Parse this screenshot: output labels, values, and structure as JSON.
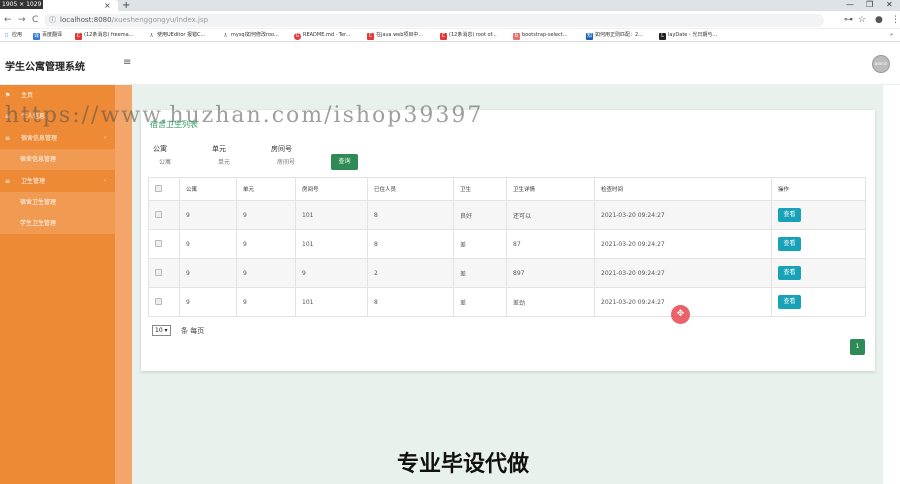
{
  "browser": {
    "tab_dim_badge": "1905 × 1029",
    "tab_close": "×",
    "new_tab": "+",
    "win_min": "—",
    "win_max": "❐",
    "win_close": "✕",
    "back": "←",
    "forward": "→",
    "reload": "C",
    "url_icon": "ⓘ",
    "url_host": "localhost:8080",
    "url_path": "/xueshenggongyu/index.jsp",
    "key_icon": "⊶",
    "star_icon": "☆",
    "profile_icon": "●",
    "menu_icon": "⋮",
    "bookmarks": [
      {
        "label": "应用",
        "color": "#4285f4",
        "icon": "⠿"
      },
      {
        "label": "百度翻译",
        "color": "#3a7bd5",
        "icon": "译"
      },
      {
        "label": "(12条消息) freema...",
        "color": "#e53935",
        "icon": "C"
      },
      {
        "label": "使用UEditor 报错C...",
        "color": "#555555",
        "icon": "ƛ"
      },
      {
        "label": "mysql如何修改roo...",
        "color": "#555555",
        "icon": "ƛ"
      },
      {
        "label": "README.md · Ter...",
        "color": "#e53935",
        "icon": "G"
      },
      {
        "label": "在java web项目中...",
        "color": "#e53935",
        "icon": "C"
      },
      {
        "label": "(12条消息) root of...",
        "color": "#e53935",
        "icon": "C"
      },
      {
        "label": "bootstrap-select...",
        "color": "#e57373",
        "icon": "b"
      },
      {
        "label": "如何用正则匹配：2...",
        "color": "#1565c0",
        "icon": "知"
      },
      {
        "label": "layDate - 光日期与...",
        "color": "#222222",
        "icon": "L"
      },
      {
        "label": "»",
        "color": "#ffffff",
        "icon": ""
      }
    ]
  },
  "app": {
    "title": "学生公寓管理系统",
    "hamburger": "≡",
    "avatar_text": "admin"
  },
  "sidebar": {
    "items": [
      {
        "icon": "⚑",
        "label": "主页",
        "arrow": ""
      },
      {
        "icon": "≡",
        "label": "个人信息",
        "arrow": ""
      },
      {
        "icon": "≡",
        "label": "宿舍信息管理",
        "arrow": "‹"
      },
      {
        "icon": "",
        "label": "宿舍信息管理",
        "arrow": ""
      },
      {
        "icon": "≡",
        "label": "卫生管理",
        "arrow": "‹"
      },
      {
        "icon": "",
        "label": "宿舍卫生管理",
        "arrow": ""
      },
      {
        "icon": "",
        "label": "学生卫生管理",
        "arrow": ""
      }
    ]
  },
  "card": {
    "title": "宿舍卫生列表",
    "filters": [
      {
        "label": "公寓",
        "placeholder": "公寓"
      },
      {
        "label": "单元",
        "placeholder": "单元"
      },
      {
        "label": "房间号",
        "placeholder": "房间号"
      }
    ],
    "query_button": "查询",
    "columns": [
      "",
      "公寓",
      "单元",
      "房间号",
      "已住人员",
      "卫生",
      "卫生详情",
      "检查时间",
      "操作"
    ],
    "rows": [
      [
        "9",
        "9",
        "101",
        "8",
        "良好",
        "还可以",
        "2021-03-20 09:24:27"
      ],
      [
        "9",
        "9",
        "101",
        "8",
        "差",
        "87",
        "2021-03-20 09:24:27"
      ],
      [
        "9",
        "9",
        "9",
        "2",
        "差",
        "897",
        "2021-03-20 09:24:27"
      ],
      [
        "9",
        "9",
        "101",
        "8",
        "差",
        "差劲",
        "2021-03-20 09:24:27"
      ]
    ],
    "view_button": "查看",
    "page_size": "10 ▾",
    "per_page_text": "条 每页",
    "current_page": "1"
  },
  "overlay": {
    "watermark": "https://www.huzhan.com/ishop39397",
    "big_text": "专业毕设代做",
    "cursor_icon": "✥"
  },
  "colors": {
    "sidebar": "#ee8a36",
    "primary_green": "#2e8b57",
    "info_button": "#17a2b8"
  }
}
